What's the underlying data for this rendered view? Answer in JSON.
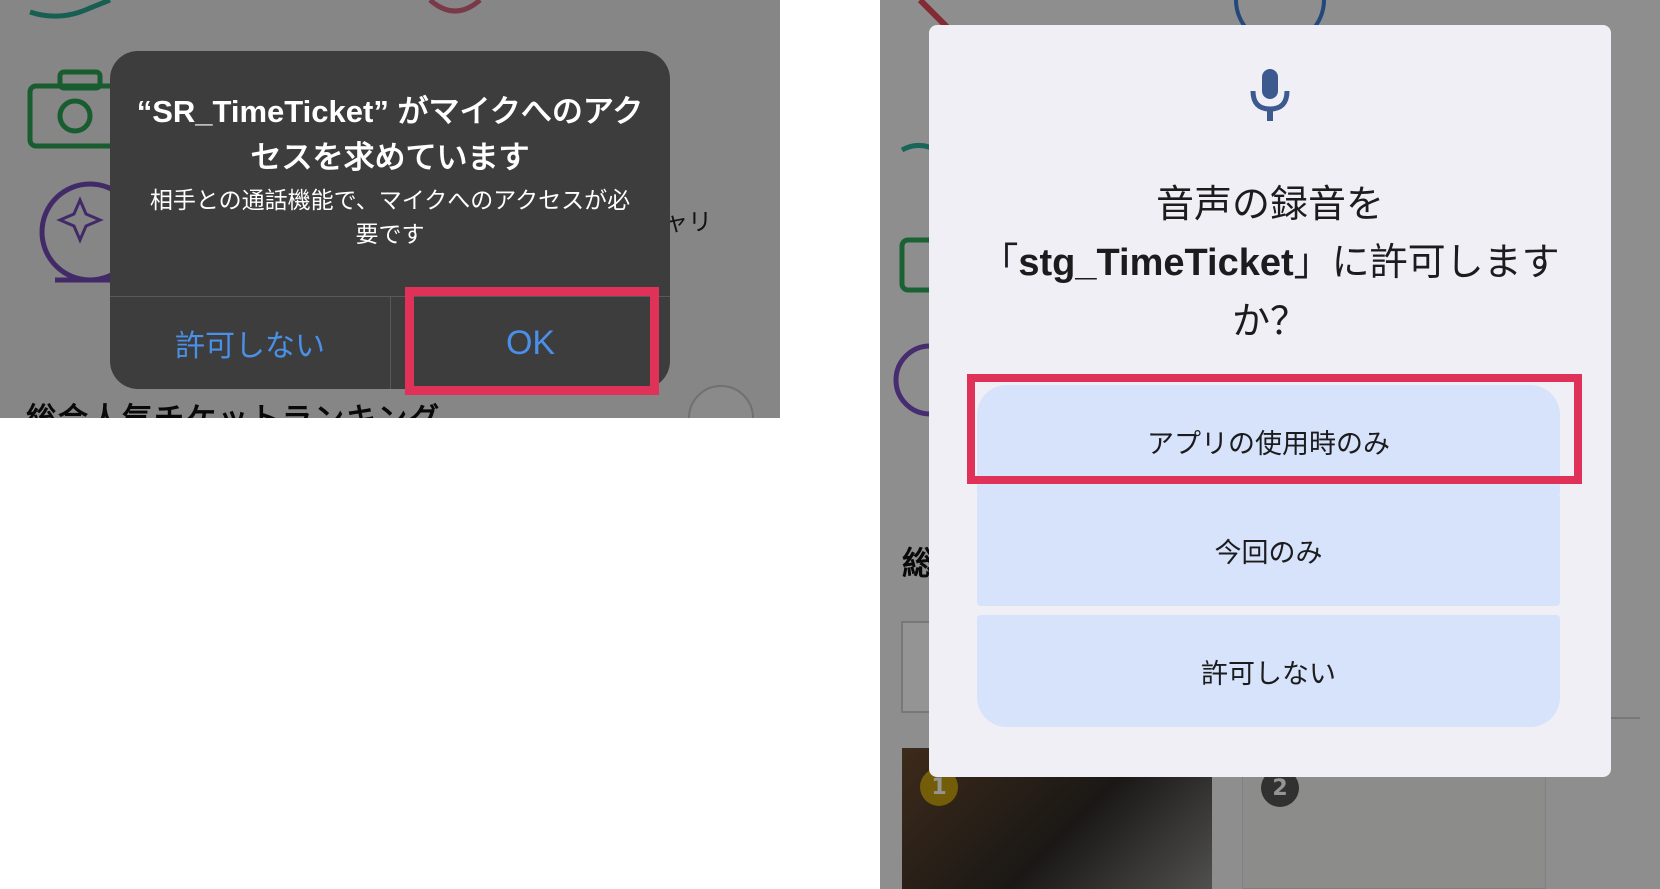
{
  "ios_dialog": {
    "title": "“SR_TimeTicket” がマイクへのアクセスを求めています",
    "message": "相手との通話機能で、マイクへのアクセスが必要です",
    "deny_label": "許可しない",
    "ok_label": "OK"
  },
  "ios_background": {
    "section_heading": "総合人気チケットランキング",
    "side_text": "ャリ"
  },
  "android_dialog": {
    "title_line1": "音声の録音を",
    "title_open": "「",
    "app_name": "stg_TimeTicket",
    "title_close": "」に許可しますか？",
    "option_while_using": "アプリの使用時のみ",
    "option_this_time": "今回のみ",
    "option_deny": "許可しない"
  },
  "android_background": {
    "side_heading": "総",
    "rank_1": "1",
    "rank_2": "2"
  },
  "icons": [
    "microphone-icon",
    "camera-icon",
    "crystal-ball-icon",
    "hand-icon",
    "heart-icon",
    "chevron-right-icon"
  ],
  "colors": {
    "highlight": "#e03258",
    "ios_alert_bg": "#3d3d3d",
    "ios_button_text": "#4a90e8",
    "android_dialog_bg": "#efeff5",
    "android_button_bg": "#d6e3fb",
    "mic_icon": "#3c5a8f"
  }
}
